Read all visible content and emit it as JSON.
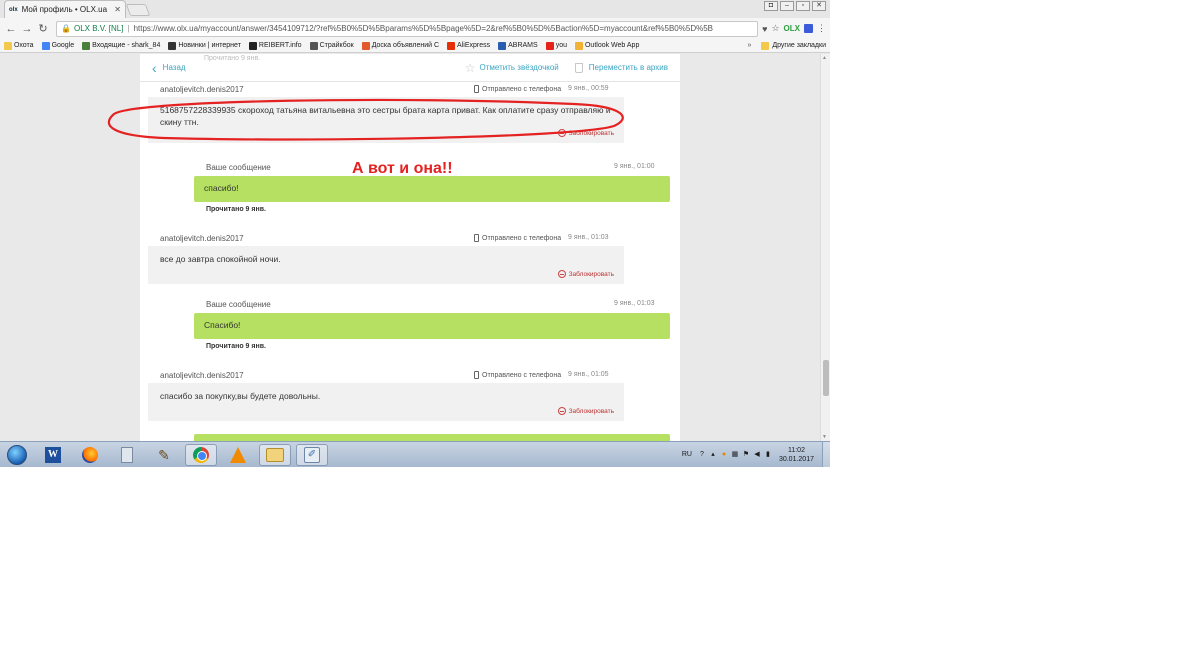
{
  "browser": {
    "tab_title": "Мой профиль • OLX.ua",
    "tab_favicon": "olx",
    "address": {
      "org": "OLX B.V. [NL]",
      "separator": "|",
      "url": "https://www.olx.ua/myaccount/answer/3454109712/?ref%5B0%5D%5Bparams%5D%5Bpage%5D=2&ref%5B0%5D%5Baction%5D=myaccount&ref%5B0%5D%5B"
    },
    "bookmarks": [
      {
        "label": "Охота",
        "color": "#f2c94c"
      },
      {
        "label": "Google",
        "color": "#4285f4"
      },
      {
        "label": "Входящие - shark_84",
        "color": "#4a7f3c"
      },
      {
        "label": "Новинки | интернет",
        "color": "#333333"
      },
      {
        "label": "REIBERT.info",
        "color": "#222222"
      },
      {
        "label": "Страйкбок",
        "color": "#555555"
      },
      {
        "label": "Доска объявлений С",
        "color": "#e05a2b"
      },
      {
        "label": "AliExpress",
        "color": "#e62e04"
      },
      {
        "label": "ABRAMS",
        "color": "#2a5db0"
      },
      {
        "label": "you",
        "color": "#e62117"
      },
      {
        "label": "Outlook Web App",
        "color": "#f2b233"
      }
    ],
    "bookmarks_more": "»",
    "bookmarks_other": "Другие закладки"
  },
  "page": {
    "back_label": "Назад",
    "star_label": "Отметить звёздочкой",
    "archive_label": "Переместить в архив",
    "peek_text": "Прочитано 9 янв.",
    "block_label": "Заблокировать",
    "your_message_label": "Ваше сообщение",
    "read_label": "Прочитано 9 янв.",
    "phone_label": "Отправлено с телефона",
    "messages": [
      {
        "sender": "anatoljevitch.denis2017",
        "time": "9 янв., 00:59",
        "text": "5168757228339935 скороход татьяна витальевна это сестры брата карта приват. Как оплатите сразу отправляю и скину ттн."
      },
      {
        "time": "9 янв., 01:00",
        "text": "спасибо!"
      },
      {
        "sender": "anatoljevitch.denis2017",
        "time": "9 янв., 01:03",
        "text": "все до завтра спокойной ночи."
      },
      {
        "time": "9 янв., 01:03",
        "text": "Спасибо!"
      },
      {
        "sender": "anatoljevitch.denis2017",
        "time": "9 янв., 01:05",
        "text": "спасибо за покупку,вы будете довольны."
      }
    ],
    "annotation": "А вот и она!!",
    "colors": {
      "accent": "#3aa5c3",
      "bubble_out": "#b5e061",
      "bubble_in": "#f1f1f1",
      "annotation": "#e52222"
    }
  },
  "taskbar": {
    "apps": [
      "start",
      "word",
      "firefox",
      "calculator",
      "tool",
      "chrome",
      "vlc",
      "explorer",
      "paint"
    ],
    "lang": "RU",
    "time": "11:02",
    "date": "30.01.2017"
  }
}
